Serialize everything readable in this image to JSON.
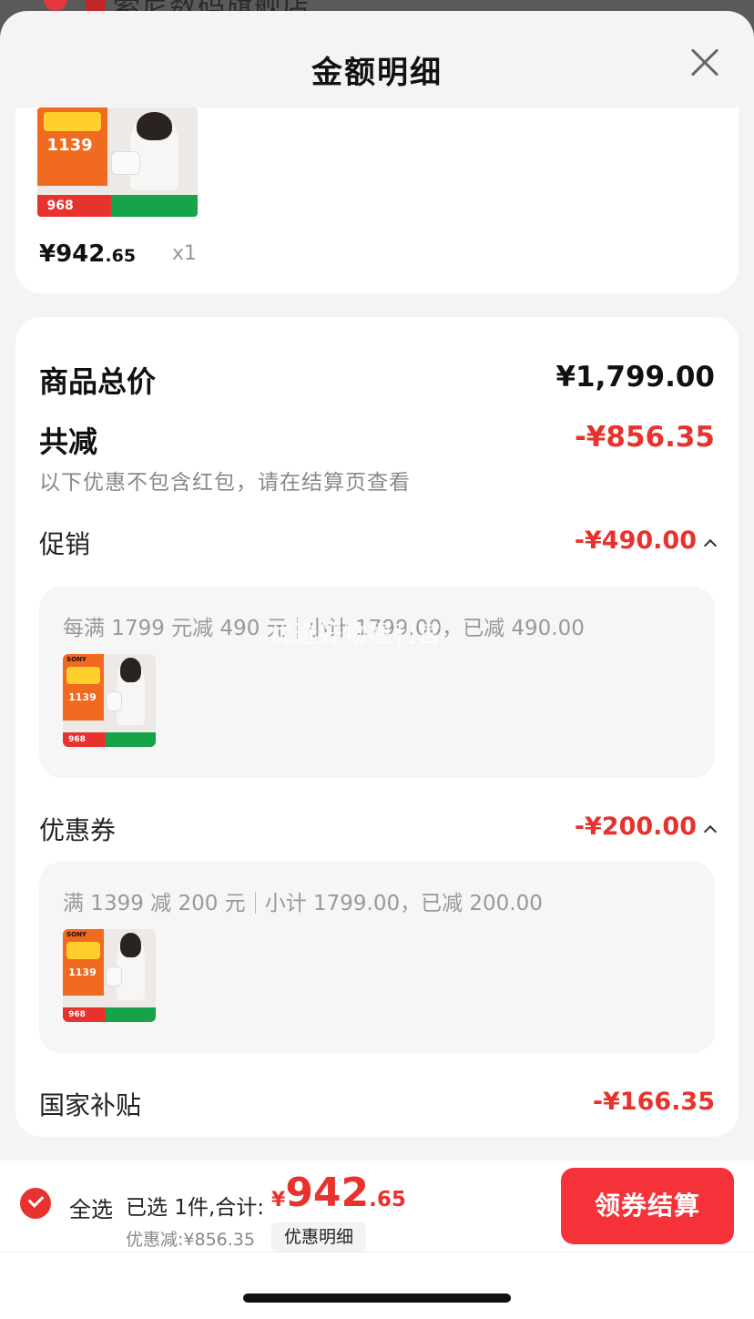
{
  "background": {
    "shop_name": "索尼数码旗舰店"
  },
  "sheet": {
    "title": "金额明细"
  },
  "product": {
    "price_int": "¥942",
    "price_cents": ".65",
    "qty": "x1",
    "art": {
      "price": "1139",
      "strip_price": "968",
      "brand": "SONY"
    }
  },
  "summary": {
    "total_label": "商品总价",
    "total_value": "¥1,799.00",
    "reduced_label": "共减",
    "reduced_value": "-¥856.35",
    "note": "以下优惠不包含红包，请在结算页查看",
    "promo": {
      "label": "促销",
      "value": "-¥490.00",
      "rule": "每满 1799 元减 490 元",
      "subtotal": "小计 1799.00，已减 490.00"
    },
    "coupon": {
      "label": "优惠券",
      "value": "-¥200.00",
      "rule": "满 1399 减 200 元",
      "subtotal": "小计 1799.00，已减 200.00"
    },
    "subsidy": {
      "label": "国家补贴",
      "value": "-¥166.35"
    },
    "watermark": "优选好物福利官"
  },
  "bottom": {
    "select_all": "全选",
    "selected_text": "已选 1件,合计:",
    "total_yen": "¥",
    "total_int": "942",
    "total_cents": ".65",
    "discount_text": "优惠减:¥856.35",
    "detail_button": "优惠明细",
    "checkout_button": "领券结算"
  },
  "colors": {
    "accent_red": "#e8322d",
    "checkout_red": "#f5323a"
  }
}
